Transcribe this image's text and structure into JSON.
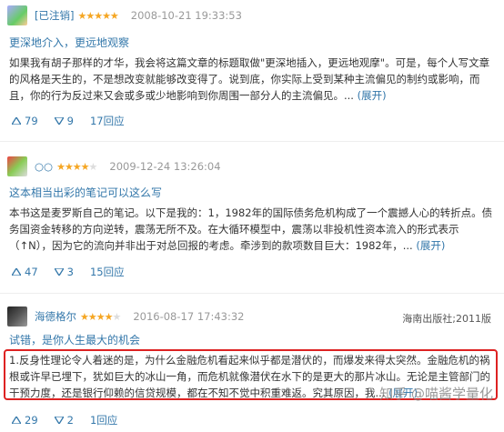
{
  "reviews": [
    {
      "user": "[已注销]",
      "rating": 5,
      "date": "2008-10-21 19:33:53",
      "source": "",
      "title": "更深地介入，更远地观察",
      "body": "如果我有胡子那样的才华，我会将这篇文章的标题取做\"更深地插入，更远地观摩\"。可是，每个人写文章的风格是天生的，不是想改变就能够改变得了。说到底，你实际上受到某种主流偏见的制约或影响，而且，你的行为反过来又会或多或少地影响到你周围一部分人的主流偏见。...",
      "expand": "(展开)",
      "up": "79",
      "down": "9",
      "replies": "17回应",
      "avatar_color": "#6f6"
    },
    {
      "user": "○○",
      "rating": 4,
      "date": "2009-12-24 13:26:04",
      "source": "",
      "title": "这本相当出彩的笔记可以这么写",
      "body": "本书这是麦罗斯自己的笔记。以下是我的：1，1982年的国际债务危机构成了一个震撼人心的转折点。债务国资金转移的方向逆转，震荡无所不及。在大循环模型中，震荡以非投机性资本流入的形式表示（↑N），因为它的流向并非出于对总回报的考虑。牵涉到的款项数目巨大：1982年，...",
      "expand": "(展开)",
      "up": "47",
      "down": "3",
      "replies": "15回应",
      "avatar_color": "#8a6"
    },
    {
      "user": "海德格尔",
      "rating": 4,
      "date": "2016-08-17 17:43:32",
      "source": "海南出版社;2011版",
      "title": "试错，是你人生最大的机会",
      "body": "1.反身性理论令人着迷的是，为什么金融危机看起来似乎都是潜伏的，而爆发来得太突然。金融危机的祸根或许早已埋下，犹如巨大的冰山一角，而危机就像潜伏在水下的是更大的那片冰山。无论是主管部门的干预力度，还是银行仰赖的信贷规模，都在不知不觉中积重难返。究其原因，我...",
      "expand": "(展开)",
      "up": "29",
      "down": "2",
      "replies": "1回应",
      "avatar_color": "#444"
    }
  ],
  "watermark": "知乎 @喵酱学量化",
  "colors": {
    "link": "#3377aa",
    "star": "#f5a623",
    "highlight": "#dd2222"
  }
}
